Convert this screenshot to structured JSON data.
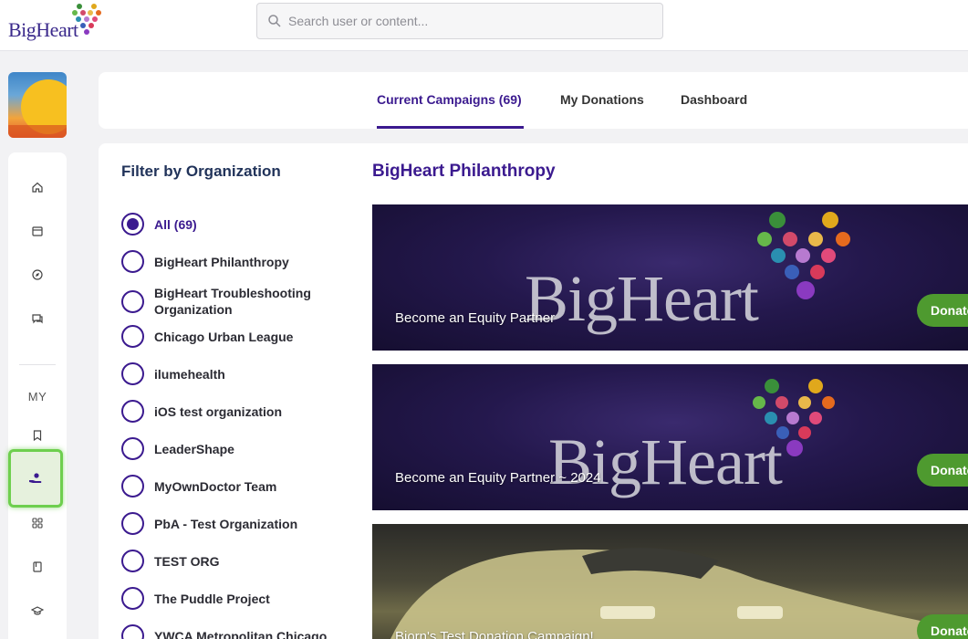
{
  "header": {
    "logo_text": "BigHeart",
    "search_placeholder": "Search user or content..."
  },
  "rail": {
    "items": [
      {
        "icon": "home-icon"
      },
      {
        "icon": "calendar-icon"
      },
      {
        "icon": "compass-icon"
      },
      {
        "icon": "chat-icon"
      },
      {
        "icon": "bookmark-icon"
      },
      {
        "icon": "donate-hand-icon"
      },
      {
        "icon": "grid-icon"
      },
      {
        "icon": "book-icon"
      },
      {
        "icon": "graduation-cap-icon"
      }
    ],
    "my_label": "MY"
  },
  "tabs": [
    {
      "label": "Current Campaigns (69)",
      "active": true
    },
    {
      "label": "My Donations",
      "active": false
    },
    {
      "label": "Dashboard",
      "active": false
    }
  ],
  "filter": {
    "title": "Filter by Organization",
    "organizations": [
      {
        "label": "All (69)",
        "checked": true
      },
      {
        "label": "BigHeart Philanthropy",
        "checked": false
      },
      {
        "label": "BigHeart Troubleshooting Organization",
        "checked": false
      },
      {
        "label": "Chicago Urban League",
        "checked": false
      },
      {
        "label": "ilumehealth",
        "checked": false
      },
      {
        "label": "iOS test organization",
        "checked": false
      },
      {
        "label": "LeaderShape",
        "checked": false
      },
      {
        "label": "MyOwnDoctor Team",
        "checked": false
      },
      {
        "label": "PbA - Test Organization",
        "checked": false
      },
      {
        "label": "TEST ORG",
        "checked": false
      },
      {
        "label": "The Puddle Project",
        "checked": false
      },
      {
        "label": "YWCA Metropolitan Chicago",
        "checked": false
      }
    ]
  },
  "main": {
    "section_title": "BigHeart Philanthropy",
    "campaigns": [
      {
        "title": "Become an Equity Partner",
        "button": "Donate",
        "banner_text": "BigHeart"
      },
      {
        "title": "Become an Equity Partner ~ 2024",
        "button": "Donate",
        "banner_text": "BigHeart"
      },
      {
        "title": "Bjorn's Test Donation Campaign!",
        "button": "Donate"
      }
    ]
  },
  "colors": {
    "brand_purple": "#3b1a8f",
    "donate_green": "#4e9a2f",
    "active_highlight": "#6ecf4e"
  }
}
